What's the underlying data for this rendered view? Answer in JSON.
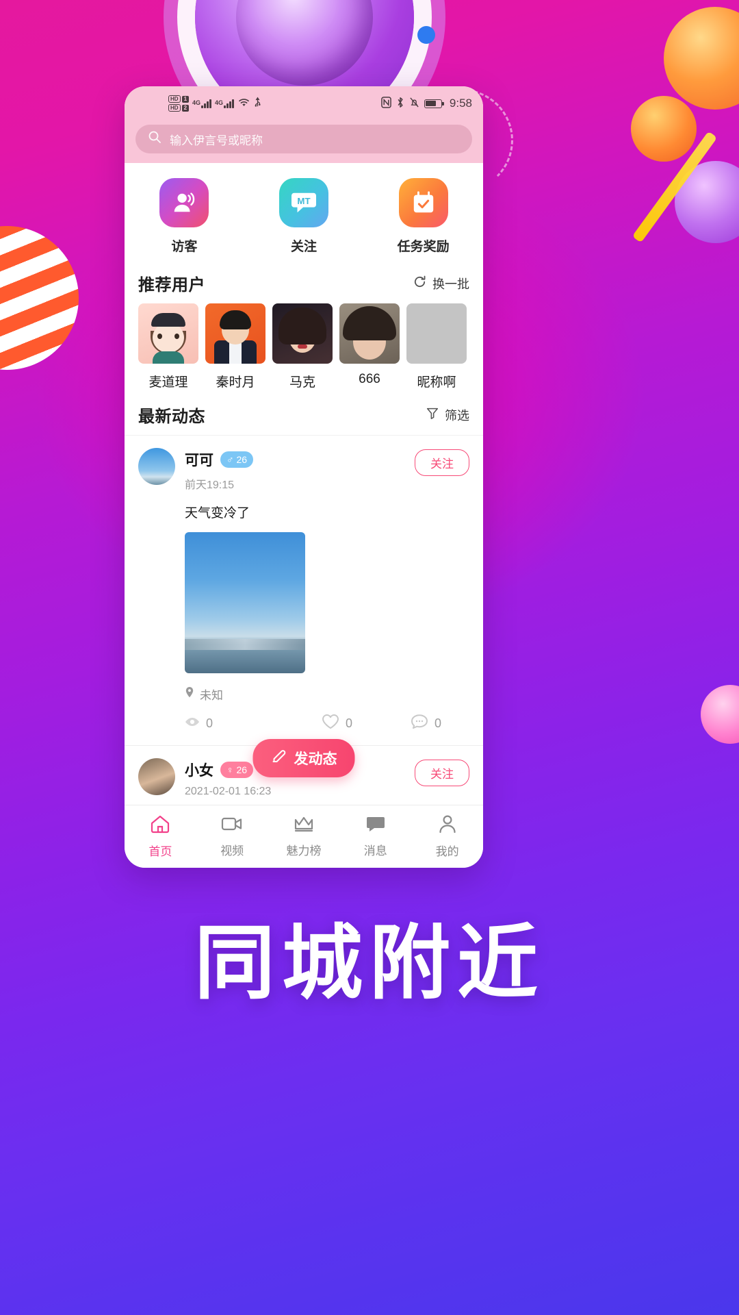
{
  "promo": {
    "headline": "同城附近"
  },
  "statusbar": {
    "hd1": "HD",
    "sim1": "1",
    "hd2": "HD",
    "sim2": "2",
    "net1": "4G",
    "net2": "4G",
    "icons": [
      "wifi-icon",
      "usb-icon",
      "nfc-icon",
      "bluetooth-icon",
      "mute-icon",
      "battery-icon"
    ],
    "time": "9:58"
  },
  "search": {
    "placeholder": "输入伊言号或昵称",
    "icon": "search-icon"
  },
  "quick_actions": [
    {
      "label": "访客",
      "icon": "visitor-icon"
    },
    {
      "label": "关注",
      "icon": "follow-message-icon"
    },
    {
      "label": "任务奖励",
      "icon": "task-reward-icon"
    }
  ],
  "recommend": {
    "title": "推荐用户",
    "refresh_label": "换一批",
    "refresh_icon": "refresh-icon",
    "users": [
      {
        "name": "麦道理"
      },
      {
        "name": "秦时月"
      },
      {
        "name": "马克"
      },
      {
        "name": "666"
      },
      {
        "name": "昵称啊"
      }
    ]
  },
  "feed": {
    "title": "最新动态",
    "filter_label": "筛选",
    "filter_icon": "filter-icon",
    "posts": [
      {
        "name": "可可",
        "gender_icon": "♂",
        "age": "26",
        "gender": "male",
        "time": "前天19:15",
        "follow_label": "关注",
        "text": "天气变冷了",
        "location": "未知",
        "location_icon": "location-pin-icon",
        "views": "0",
        "views_icon": "eye-icon",
        "likes": "0",
        "likes_icon": "heart-icon",
        "comments": "0",
        "comments_icon": "comment-icon"
      },
      {
        "name": "小女",
        "gender_icon": "♀",
        "age": "26",
        "gender": "female",
        "time": "2021-02-01 16:23",
        "follow_label": "关注"
      }
    ]
  },
  "compose": {
    "label": "发动态",
    "icon": "edit-pencil-icon"
  },
  "tabbar": [
    {
      "label": "首页",
      "icon": "home-icon",
      "active": true
    },
    {
      "label": "视频",
      "icon": "video-icon",
      "active": false
    },
    {
      "label": "魅力榜",
      "icon": "crown-icon",
      "active": false
    },
    {
      "label": "消息",
      "icon": "message-icon",
      "active": false
    },
    {
      "label": "我的",
      "icon": "profile-icon",
      "active": false
    }
  ],
  "colors": {
    "accent": "#f2418a",
    "follow": "#f74a77",
    "male": "#7cc6f5",
    "female": "#ff7f9e"
  }
}
